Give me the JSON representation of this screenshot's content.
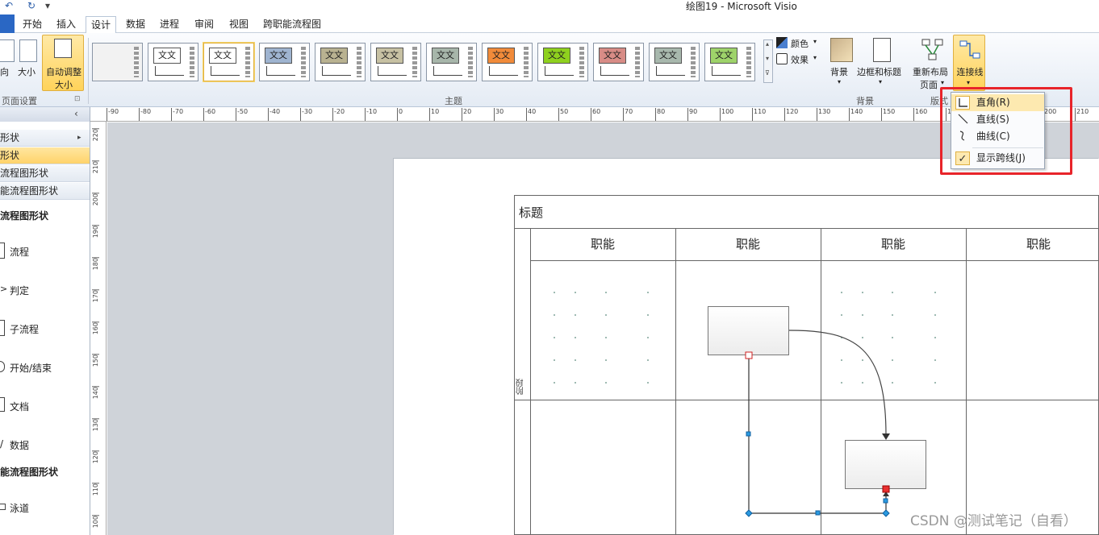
{
  "window": {
    "title": "绘图19 - Microsoft Visio"
  },
  "quick_access": {
    "undo": "↶",
    "redo": "↻",
    "customize": "▾"
  },
  "tabs": [
    {
      "label": "开始"
    },
    {
      "label": "插入"
    },
    {
      "label": "设计"
    },
    {
      "label": "数据"
    },
    {
      "label": "进程"
    },
    {
      "label": "审阅"
    },
    {
      "label": "视图"
    },
    {
      "label": "跨职能流程图"
    }
  ],
  "active_tab": "设计",
  "ribbon": {
    "page_setup": {
      "orientation": "向",
      "size": "大小",
      "auto_fit_line1": "自动调整",
      "auto_fit_line2": "大小",
      "group": "页面设置"
    },
    "themes": {
      "group": "主题",
      "sample": "文文",
      "items": [
        {
          "fill": "#ffffff"
        },
        {
          "fill": "#ffffff"
        },
        {
          "fill": "#ffffff"
        },
        {
          "fill": "#9fb4d0"
        },
        {
          "fill": "#b9b291"
        },
        {
          "fill": "#c7c1a3"
        },
        {
          "fill": "#a7b6aa"
        },
        {
          "fill": "#f18b3a"
        },
        {
          "fill": "#8fd11e"
        },
        {
          "fill": "#d88c86"
        },
        {
          "fill": "#a8b8ad"
        },
        {
          "fill": "#9ed36a"
        }
      ]
    },
    "variants": {
      "colors": "颜色",
      "effects": "效果"
    },
    "backgrounds": {
      "background": "背景",
      "borders_titles": "边框和标题",
      "group": "背景"
    },
    "layout": {
      "relayout_line1": "重新布局",
      "relayout_line2": "页面",
      "connectors": "连接线",
      "group": "版式"
    }
  },
  "connector_menu": {
    "items": [
      {
        "label": "直角(R)",
        "icon": "right-angle-connector"
      },
      {
        "label": "直线(S)",
        "icon": "straight-connector"
      },
      {
        "label": "曲线(C)",
        "icon": "curved-connector"
      },
      {
        "label": "显示跨线(J)",
        "icon": "checkmark",
        "checked": true
      }
    ]
  },
  "shapes_panel": {
    "collapse": "‹",
    "rows": [
      {
        "label": "形状",
        "arrow": "▸"
      },
      {
        "label": "形状",
        "selected": true
      },
      {
        "label": "流程图形状"
      },
      {
        "label": "能流程图形状"
      }
    ],
    "section1": "流程图形状",
    "stencil": [
      {
        "label": "流程",
        "icon": "process-shape-icon"
      },
      {
        "label": "判定",
        "icon": "decision-shape-icon"
      },
      {
        "label": "子流程",
        "icon": "subprocess-shape-icon"
      },
      {
        "label": "开始/结束",
        "icon": "terminator-shape-icon"
      },
      {
        "label": "文档",
        "icon": "document-shape-icon"
      },
      {
        "label": "数据",
        "icon": "data-shape-icon"
      }
    ],
    "section2": "能流程图形状",
    "swimlane": "泳道"
  },
  "ruler": {
    "top_ticks": [
      "-90",
      "-80",
      "-70",
      "-60",
      "-50",
      "-40",
      "-30",
      "-20",
      "-10",
      "0",
      "10",
      "20",
      "30",
      "40",
      "50",
      "60",
      "70",
      "80",
      "90",
      "100",
      "110",
      "120",
      "130",
      "140",
      "150",
      "160",
      "170",
      "180",
      "190",
      "200",
      "210"
    ],
    "left_ticks": [
      "220",
      "210",
      "200",
      "190",
      "180",
      "170",
      "160",
      "150",
      "140",
      "130",
      "120",
      "110",
      "100"
    ]
  },
  "diagram": {
    "title": "标题",
    "functions": [
      "职能",
      "职能",
      "职能",
      "职能"
    ],
    "phase": "阶段"
  },
  "watermark": "CSDN @测试笔记（自看）",
  "colors": {
    "accent": "#2a67c4",
    "highlight": "#e8242a"
  }
}
